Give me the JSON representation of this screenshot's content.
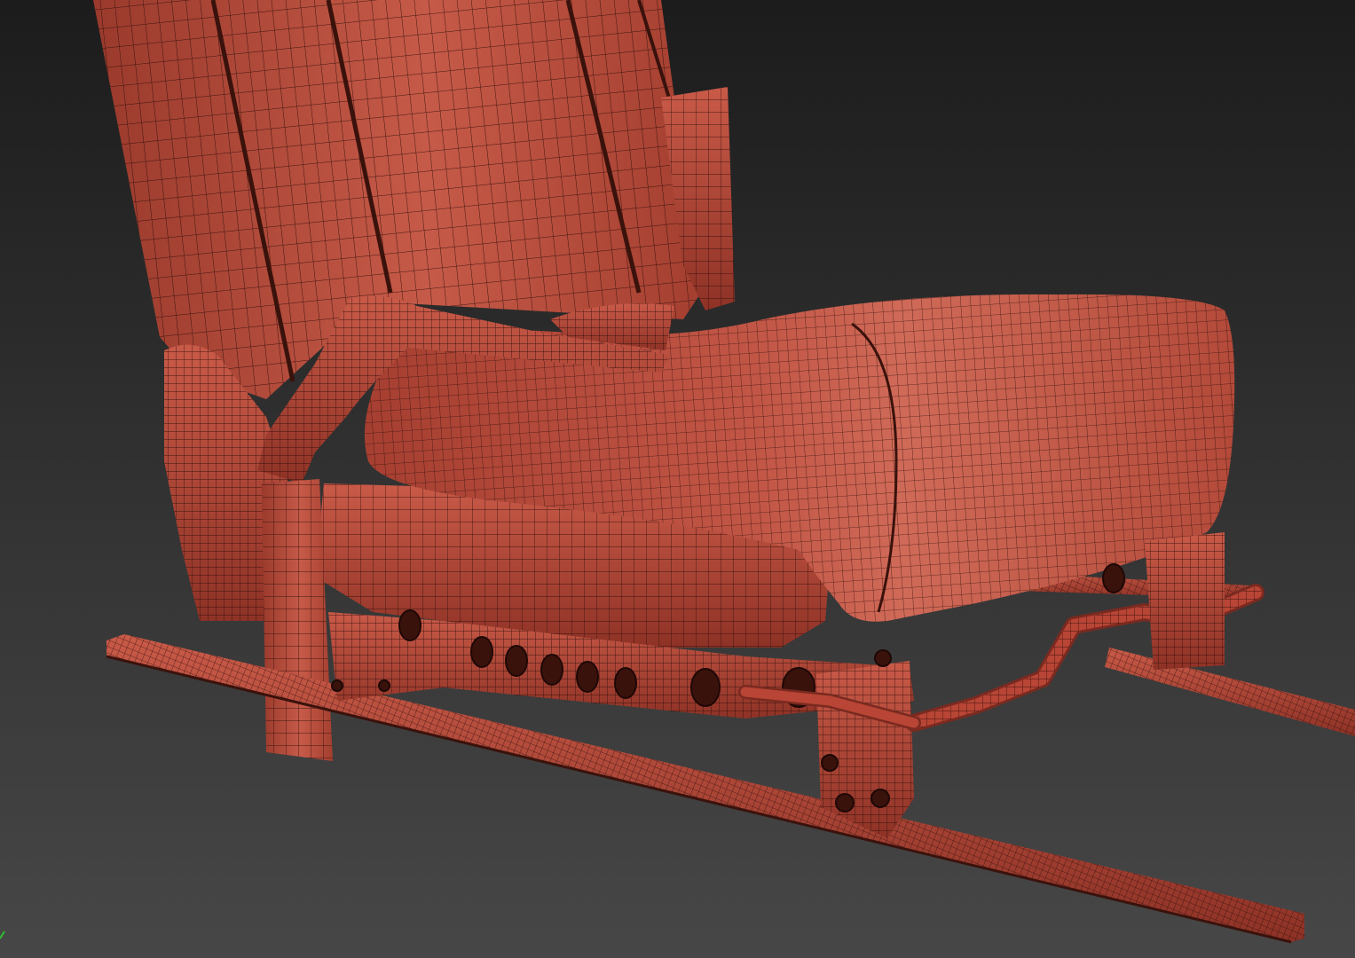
{
  "viewport": {
    "background": {
      "top_color": "#1c1c1c",
      "bottom_color": "#474747"
    },
    "model": {
      "material_color": "#b84535",
      "material_light": "#c95a48",
      "material_dark": "#7a2a20",
      "wire_color": "#2a0c08"
    },
    "axis_gizmo": {
      "color": "#2fbf2f"
    }
  }
}
